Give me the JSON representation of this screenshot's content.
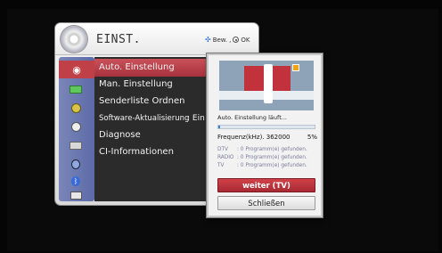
{
  "menu": {
    "title": "EINST.",
    "hint_move": "Bew.",
    "hint_ok": "OK",
    "items": [
      {
        "label": "Auto. Einstellung",
        "value": ""
      },
      {
        "label": "Man. Einstellung",
        "value": ""
      },
      {
        "label": "Senderliste Ordnen",
        "value": ""
      },
      {
        "label": "Software-Aktualisierung",
        "value": ": Ein"
      },
      {
        "label": "Diagnose",
        "value": ""
      },
      {
        "label": "CI-Informationen",
        "value": ""
      }
    ],
    "icons": [
      "settings-disc-icon",
      "picture-icon",
      "audio-icon",
      "clock-icon",
      "option-icon",
      "lock-icon",
      "bluetooth-icon",
      "network-icon"
    ]
  },
  "popup": {
    "status": "Auto. Einstellung läuft...",
    "progress": 0.02,
    "freq_label": "Frequenz(kHz). 362000",
    "freq_percent": "5%",
    "results": [
      {
        "k": "DTV",
        "v": ": 0 Programm(e) gefunden."
      },
      {
        "k": "RADIO",
        "v": ": 0 Programm(e) gefunden."
      },
      {
        "k": "TV",
        "v": ": 0 Programm(e) gefunden."
      }
    ],
    "btn_continue": "weiter (TV)",
    "btn_close": "Schließen"
  },
  "colors": {
    "accent_red": "#b43a43",
    "progress_blue": "#3e7fd3",
    "list_bg": "#2b2b2b"
  }
}
